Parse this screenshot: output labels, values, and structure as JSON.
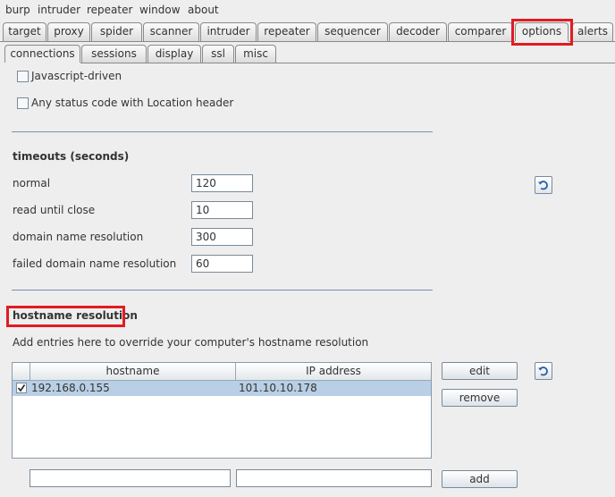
{
  "menubar": {
    "items": [
      "burp",
      "intruder",
      "repeater",
      "window",
      "about"
    ]
  },
  "main_tabs": [
    {
      "label": "target"
    },
    {
      "label": "proxy"
    },
    {
      "label": "spider"
    },
    {
      "label": "scanner"
    },
    {
      "label": "intruder"
    },
    {
      "label": "repeater"
    },
    {
      "label": "sequencer"
    },
    {
      "label": "decoder"
    },
    {
      "label": "comparer"
    },
    {
      "label": "options",
      "selected": true
    },
    {
      "label": "alerts"
    }
  ],
  "sub_tabs": [
    {
      "label": "connections",
      "selected": true
    },
    {
      "label": "sessions"
    },
    {
      "label": "display"
    },
    {
      "label": "ssl"
    },
    {
      "label": "misc"
    }
  ],
  "redirect_options": {
    "javascript_driven": {
      "label": "Javascript-driven",
      "checked": false
    },
    "any_status_location": {
      "label": "Any status code with Location header",
      "checked": false
    }
  },
  "timeouts": {
    "heading": "timeouts (seconds)",
    "normal": {
      "label": "normal",
      "value": "120"
    },
    "read_until_close": {
      "label": "read until close",
      "value": "10"
    },
    "dns_resolution": {
      "label": "domain name resolution",
      "value": "300"
    },
    "failed_dns_resolution": {
      "label": "failed domain name resolution",
      "value": "60"
    }
  },
  "hostname_resolution": {
    "heading": "hostname resolution",
    "description": "Add entries here to override your computer's hostname resolution",
    "columns": [
      "hostname",
      "IP address"
    ],
    "rows": [
      {
        "enabled": true,
        "hostname": "192.168.0.155",
        "ip": "101.10.10.178"
      }
    ],
    "buttons": {
      "edit": "edit",
      "remove": "remove",
      "add": "add"
    },
    "new_hostname": "",
    "new_ip": ""
  },
  "colors": {
    "highlight": "#e11b22",
    "selection": "#b8cfe5",
    "separator": "#7c8fb5",
    "icon_blue": "#2a5fa8"
  },
  "icons": {
    "restore_defaults": "refresh-icon",
    "checkmark": "check-icon"
  }
}
